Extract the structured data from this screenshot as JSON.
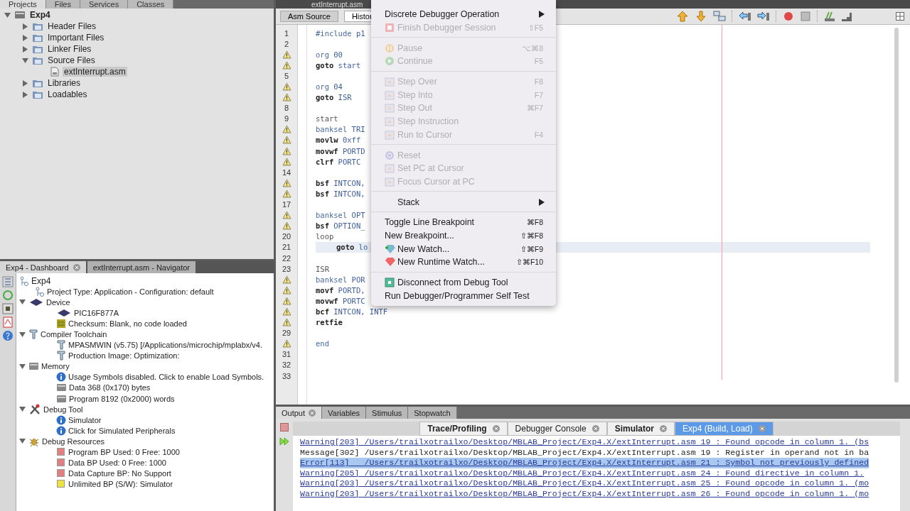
{
  "projects_panel": {
    "tabs": [
      {
        "label": "Projects",
        "selected": true
      },
      {
        "label": "Files",
        "selected": false
      },
      {
        "label": "Services",
        "selected": false
      },
      {
        "label": "Classes",
        "selected": false
      }
    ],
    "tree": [
      {
        "label": "Exp4",
        "kind": "project",
        "expanded": true,
        "children": [
          {
            "label": "Header Files",
            "kind": "folder",
            "expanded": false
          },
          {
            "label": "Important Files",
            "kind": "folder",
            "expanded": false
          },
          {
            "label": "Linker Files",
            "kind": "folder",
            "expanded": false
          },
          {
            "label": "Source Files",
            "kind": "folder",
            "expanded": true,
            "children": [
              {
                "label": "extInterrupt.asm",
                "kind": "file",
                "selected": true
              }
            ]
          },
          {
            "label": "Libraries",
            "kind": "folder",
            "expanded": false
          },
          {
            "label": "Loadables",
            "kind": "folder",
            "expanded": false
          }
        ]
      }
    ]
  },
  "dashboard": {
    "tabs": [
      {
        "label": "Exp4 - Dashboard",
        "selected": true
      },
      {
        "label": "extInterrupt.asm - Navigator",
        "selected": false
      }
    ],
    "tree": [
      {
        "label": "Exp4",
        "kind": "project",
        "children": [
          {
            "label": "Project Type: Application - Configuration: default",
            "kind": "project"
          },
          {
            "label": "Device",
            "kind": "chip",
            "expanded": true,
            "children": [
              {
                "label": "PIC16F877A",
                "kind": "chip"
              },
              {
                "label": "Checksum: Blank, no code loaded",
                "kind": "checksum"
              }
            ]
          },
          {
            "label": "Compiler Toolchain",
            "kind": "toolchain",
            "expanded": true,
            "children": [
              {
                "label": "MPASMWIN (v5.75) [/Applications/microchip/mplabx/v4.",
                "kind": "toolchain"
              },
              {
                "label": "Production Image: Optimization:",
                "kind": "toolchain"
              }
            ]
          },
          {
            "label": "Memory",
            "kind": "memory",
            "expanded": true,
            "children": [
              {
                "label": "Usage Symbols disabled. Click to enable Load Symbols.",
                "kind": "info"
              },
              {
                "label": "Data 368 (0x170) bytes",
                "kind": "memory"
              },
              {
                "label": "Program 8192 (0x2000) words",
                "kind": "memory"
              }
            ]
          },
          {
            "label": "Debug Tool",
            "kind": "debug-tool",
            "expanded": true,
            "children": [
              {
                "label": "Simulator",
                "kind": "info"
              },
              {
                "label": "Click for Simulated Peripherals",
                "kind": "info"
              }
            ]
          },
          {
            "label": "Debug Resources",
            "kind": "bug",
            "expanded": true,
            "children": [
              {
                "label": "Program BP Used: 0  Free: 1000",
                "kind": "resource",
                "color": "#e08080"
              },
              {
                "label": "Data BP Used: 0  Free: 1000",
                "kind": "resource",
                "color": "#e08080"
              },
              {
                "label": "Data Capture BP: No Support",
                "kind": "resource",
                "color": "#e08080"
              },
              {
                "label": "Unlimited BP (S/W): Simulator",
                "kind": "resource",
                "color": "#f0e040"
              }
            ]
          }
        ]
      }
    ]
  },
  "editor": {
    "file_tab": "extInterrupt.asm",
    "view_tabs": [
      {
        "label": "Asm Source",
        "selected": true
      },
      {
        "label": "Histor",
        "selected": false
      }
    ],
    "lines": [
      {
        "number": "1",
        "kind": "directive",
        "op": "#include",
        "args": "p1"
      },
      {
        "number": "2",
        "kind": "blank"
      },
      {
        "warning": true,
        "kind": "directive",
        "op": "org",
        "args": "00"
      },
      {
        "warning": true,
        "kind": "instr",
        "op": "goto",
        "args": "start"
      },
      {
        "number": "5",
        "kind": "blank"
      },
      {
        "warning": true,
        "kind": "directive",
        "op": "org",
        "args": "04"
      },
      {
        "warning": true,
        "kind": "instr",
        "op": "goto",
        "args": "ISR"
      },
      {
        "number": "8",
        "kind": "blank"
      },
      {
        "number": "9",
        "kind": "label",
        "op": "start"
      },
      {
        "warning": true,
        "kind": "directive",
        "op": "banksel",
        "args": "TRI"
      },
      {
        "warning": true,
        "kind": "instr",
        "op": "movlw",
        "args": "0xff"
      },
      {
        "warning": true,
        "kind": "instr",
        "op": "movwf",
        "args": "PORTD"
      },
      {
        "warning": true,
        "kind": "instr",
        "op": "clrf",
        "args": "PORTC"
      },
      {
        "number": "14",
        "kind": "blank"
      },
      {
        "warning": true,
        "kind": "instr",
        "op": "bsf",
        "args": "INTCON,"
      },
      {
        "warning": true,
        "kind": "instr",
        "op": "bsf",
        "args": "INTCON,"
      },
      {
        "number": "17",
        "kind": "blank"
      },
      {
        "warning": true,
        "kind": "directive",
        "op": "banksel",
        "args": "OPT"
      },
      {
        "warning": true,
        "kind": "instr",
        "op": "bsf",
        "args": "OPTION_"
      },
      {
        "number": "20",
        "kind": "label",
        "op": "loop"
      },
      {
        "number": "21",
        "kind": "instr",
        "op": "goto",
        "args": "lo",
        "indented": true,
        "current": true
      },
      {
        "number": "22",
        "kind": "blank"
      },
      {
        "number": "23",
        "kind": "label",
        "op": "ISR"
      },
      {
        "warning": true,
        "kind": "directive",
        "op": "banksel",
        "args": "POR"
      },
      {
        "warning": true,
        "kind": "instr",
        "op": "movf",
        "args": "PORTD,"
      },
      {
        "warning": true,
        "kind": "instr",
        "op": "movwf",
        "args": "PORTC"
      },
      {
        "warning": true,
        "kind": "instr",
        "op": "bcf",
        "args": "INTCON, INTF"
      },
      {
        "warning": true,
        "kind": "instr",
        "op": "retfie"
      },
      {
        "number": "29",
        "kind": "blank"
      },
      {
        "warning": true,
        "kind": "directive",
        "op": "end"
      },
      {
        "number": "31",
        "kind": "blank"
      },
      {
        "number": "32",
        "kind": "blank"
      },
      {
        "number": "33",
        "kind": "blank"
      }
    ]
  },
  "debug_menu": [
    {
      "kind": "submenu",
      "label": "Discrete Debugger Operation",
      "disabled": false
    },
    {
      "kind": "item",
      "label": "Finish Debugger Session",
      "shortcut": "⇧F5",
      "disabled": true
    },
    {
      "kind": "separator"
    },
    {
      "kind": "item",
      "label": "Pause",
      "shortcut": "⌥⌘8",
      "disabled": true
    },
    {
      "kind": "item",
      "label": "Continue",
      "shortcut": "F5",
      "disabled": true
    },
    {
      "kind": "separator"
    },
    {
      "kind": "item",
      "label": "Step Over",
      "shortcut": "F8",
      "disabled": true
    },
    {
      "kind": "item",
      "label": "Step Into",
      "shortcut": "F7",
      "disabled": true
    },
    {
      "kind": "item",
      "label": "Step Out",
      "shortcut": "⌘F7",
      "disabled": true
    },
    {
      "kind": "item",
      "label": "Step Instruction",
      "disabled": true
    },
    {
      "kind": "item",
      "label": "Run to Cursor",
      "shortcut": "F4",
      "disabled": true
    },
    {
      "kind": "separator"
    },
    {
      "kind": "item",
      "label": "Reset",
      "disabled": true
    },
    {
      "kind": "item",
      "label": "Set PC at Cursor",
      "disabled": true
    },
    {
      "kind": "item",
      "label": "Focus Cursor at PC",
      "disabled": true
    },
    {
      "kind": "separator"
    },
    {
      "kind": "submenu",
      "label": "Stack",
      "disabled": false,
      "inset": true
    },
    {
      "kind": "separator"
    },
    {
      "kind": "item",
      "label": "Toggle Line Breakpoint",
      "shortcut": "⌘F8",
      "disabled": false
    },
    {
      "kind": "item",
      "label": "New Breakpoint...",
      "shortcut": "⇧⌘F8",
      "disabled": false
    },
    {
      "kind": "item",
      "label": "New Watch...",
      "shortcut": "⇧⌘F9",
      "disabled": false
    },
    {
      "kind": "item",
      "label": "New Runtime Watch...",
      "shortcut": "⇧⌘F10",
      "disabled": false
    },
    {
      "kind": "separator"
    },
    {
      "kind": "item",
      "label": "Disconnect from Debug Tool",
      "disabled": false
    },
    {
      "kind": "item",
      "label": "Run Debugger/Programmer Self Test",
      "disabled": false
    }
  ],
  "output_panel": {
    "tabs": [
      {
        "label": "Output",
        "selected": true
      },
      {
        "label": "Variables",
        "selected": false
      },
      {
        "label": "Stimulus",
        "selected": false
      },
      {
        "label": "Stopwatch",
        "selected": false
      }
    ],
    "sub_tabs": [
      {
        "label": "Trace/Profiling",
        "selected": false
      },
      {
        "label": "Debugger Console",
        "selected": false
      },
      {
        "label": "Simulator",
        "selected": false
      },
      {
        "label": "Exp4 (Build, Load)",
        "selected": true
      }
    ],
    "log": [
      {
        "kind": "link",
        "selected": false,
        "text": "Warning[203] /Users/trailxotrailxo/Desktop/MBLAB_Project/Exp4.X/extInterrupt.asm 19 : Found opcode in column 1. (bs"
      },
      {
        "kind": "plain",
        "selected": false,
        "text": "Message[302] /Users/trailxotrailxo/Desktop/MBLAB_Project/Exp4.X/extInterrupt.asm 19 : Register in operand not in ba"
      },
      {
        "kind": "link",
        "selected": true,
        "text": "Error[113]   /Users/trailxotrailxo/Desktop/MBLAB_Project/Exp4.X/extInterrupt.asm 21 : Symbol not previously defined"
      },
      {
        "kind": "link",
        "selected": false,
        "text": "Warning[205] /Users/trailxotrailxo/Desktop/MBLAB_Project/Exp4.X/extInterrupt.asm 24 : Found directive in column 1."
      },
      {
        "kind": "link",
        "selected": false,
        "text": "Warning[203] /Users/trailxotrailxo/Desktop/MBLAB_Project/Exp4.X/extInterrupt.asm 25 : Found opcode in column 1. (mo"
      },
      {
        "kind": "link",
        "selected": false,
        "text": "Warning[203] /Users/trailxotrailxo/Desktop/MBLAB_Project/Exp4.X/extInterrupt.asm 26 : Found opcode in column 1. (mo"
      }
    ]
  }
}
